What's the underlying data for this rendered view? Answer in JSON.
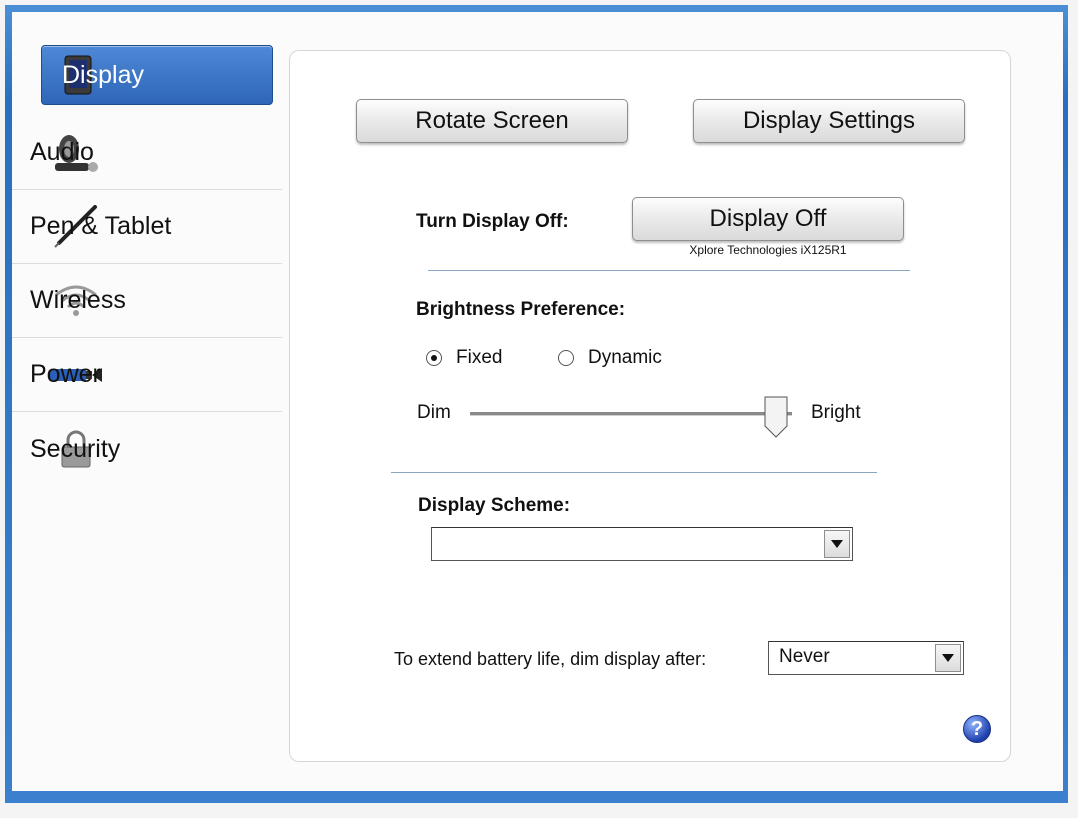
{
  "sidebar": {
    "items": [
      {
        "label": "Display",
        "icon": "tablet-icon",
        "active": true
      },
      {
        "label": "Audio",
        "icon": "speaker-icon"
      },
      {
        "label": "Pen & Tablet",
        "icon": "pen-icon"
      },
      {
        "label": "Wireless",
        "icon": "wireless-icon"
      },
      {
        "label": "Power",
        "icon": "battery-icon"
      },
      {
        "label": "Security",
        "icon": "lock-icon"
      }
    ]
  },
  "display": {
    "rotate_button": "Rotate Screen",
    "settings_button": "Display Settings",
    "turn_off_label": "Turn Display Off:",
    "display_off_button": "Display Off",
    "device_caption": "Xplore Technologies iX125R1",
    "brightness_label": "Brightness Preference:",
    "fixed_label": "Fixed",
    "dynamic_label": "Dynamic",
    "brightness_mode": "Fixed",
    "dim_label": "Dim",
    "bright_label": "Bright",
    "brightness_level": 0.98,
    "scheme_label": "Display Scheme:",
    "scheme_value": "",
    "dim_after_label": "To extend battery life, dim display after:",
    "dim_after_value": "Never"
  },
  "colors": {
    "accent": "#2f66b8",
    "frame": "#2a6fbf"
  }
}
